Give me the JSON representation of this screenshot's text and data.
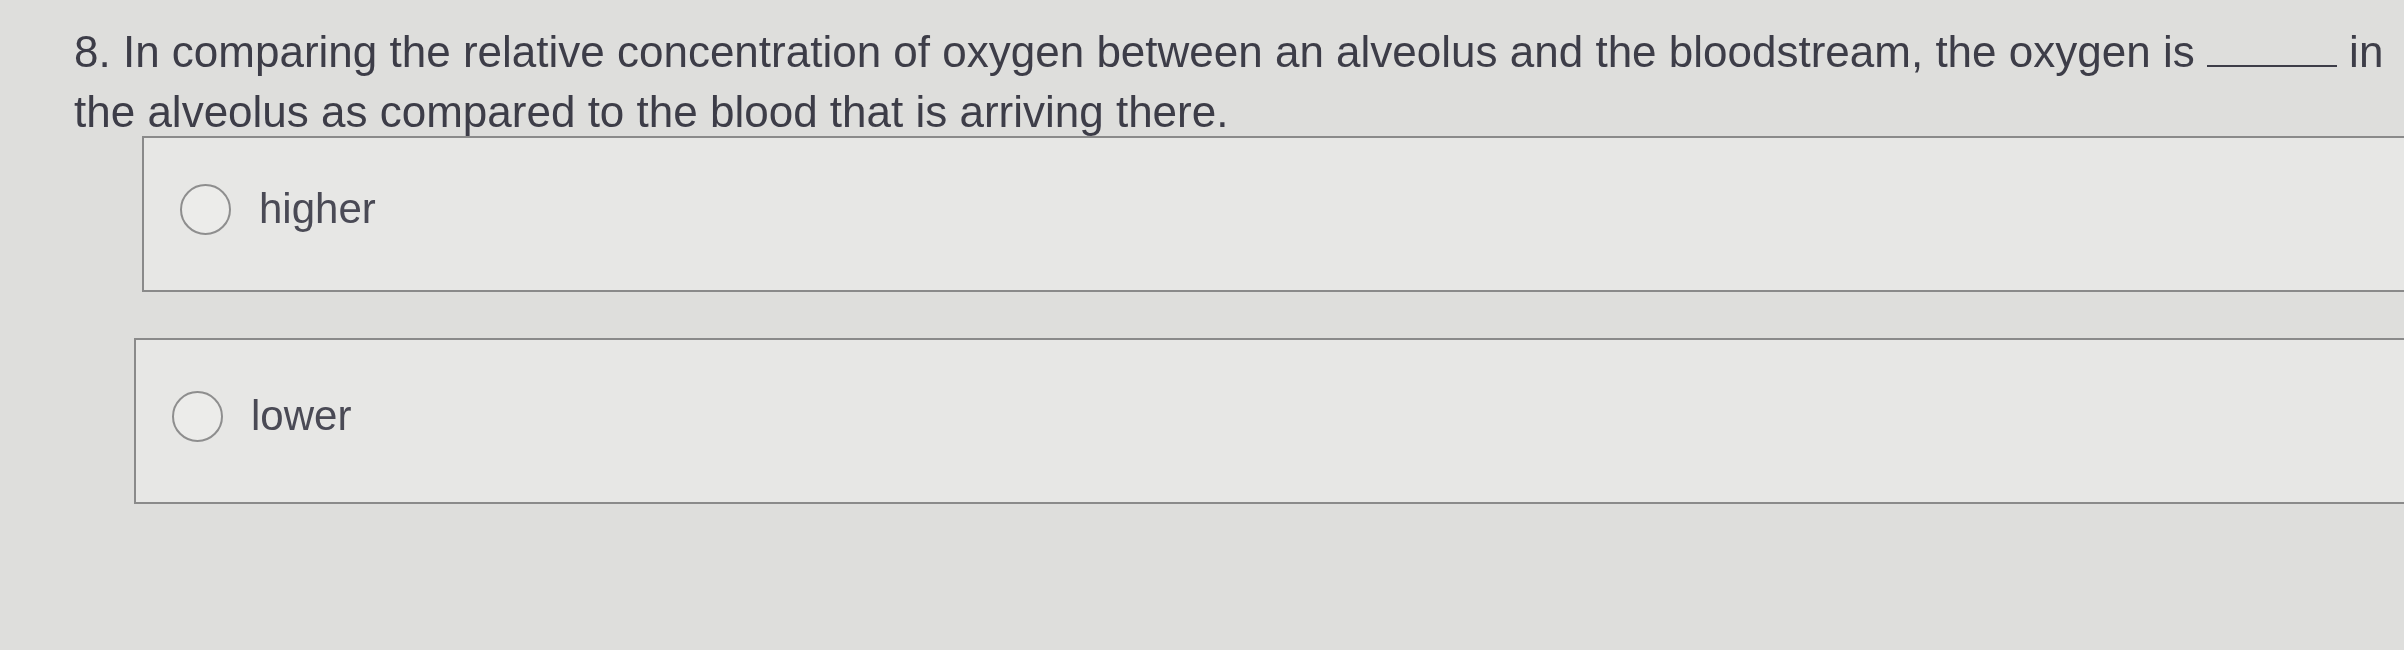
{
  "question": {
    "text_before": "8. In comparing the relative concentration of oxygen between an alveolus and the bloodstream, the oxygen is",
    "text_after": "in the alveolus as compared to the blood that is arriving there."
  },
  "options": [
    {
      "label": "higher",
      "selected": false
    },
    {
      "label": "lower",
      "selected": false
    }
  ]
}
